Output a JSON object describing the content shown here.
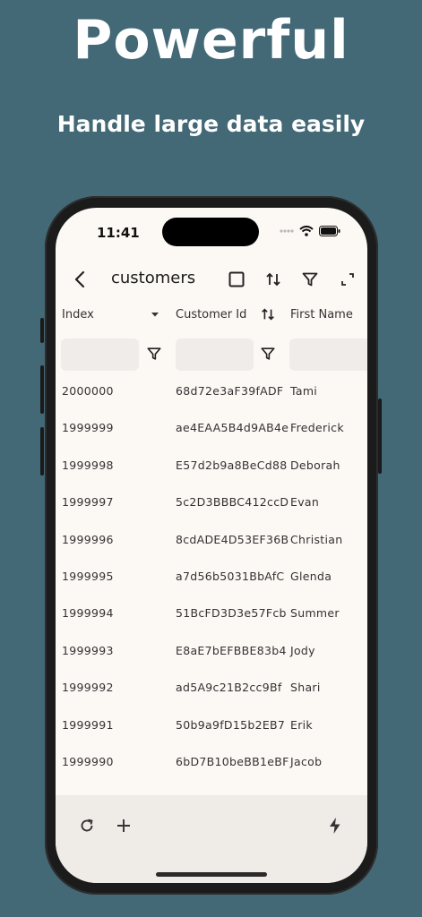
{
  "promo": {
    "headline": "Powerful",
    "subheadline": "Handle large data easily"
  },
  "status_bar": {
    "time": "11:41"
  },
  "toolbar": {
    "title": "customers",
    "icons": [
      "back-arrow-icon",
      "checkbox-icon",
      "sort-icon",
      "filter-icon",
      "fullscreen-icon"
    ]
  },
  "table": {
    "columns": [
      {
        "label": "Index",
        "icon": "dropdown-arrow-icon"
      },
      {
        "label": "Customer Id",
        "icon": "sort-icon"
      },
      {
        "label": "First Name"
      }
    ],
    "filters": [
      {
        "value": "",
        "placeholder": ""
      },
      {
        "value": "",
        "placeholder": ""
      },
      {
        "value": "",
        "placeholder": ""
      }
    ],
    "rows": [
      [
        "2000000",
        "68d72e3aF39fADF",
        "Tami"
      ],
      [
        "1999999",
        "ae4EAA5B4d9AB4e",
        "Frederick"
      ],
      [
        "1999998",
        "E57d2b9a8BeCd88",
        "Deborah"
      ],
      [
        "1999997",
        "5c2D3BBBC412ccD",
        "Evan"
      ],
      [
        "1999996",
        "8cdADE4D53EF36B",
        "Christian"
      ],
      [
        "1999995",
        "a7d56b5031BbAfC",
        "Glenda"
      ],
      [
        "1999994",
        "51BcFD3D3e57Fcb",
        "Summer"
      ],
      [
        "1999993",
        "E8aE7bEFBBE83b4",
        "Jody"
      ],
      [
        "1999992",
        "ad5A9c21B2cc9Bf",
        "Shari"
      ],
      [
        "1999991",
        "50b9a9fD15b2EB7",
        "Erik"
      ],
      [
        "1999990",
        "6bD7B10beBB1eBF",
        "Jacob"
      ]
    ]
  },
  "bottom_bar": {
    "icons": [
      "refresh-icon",
      "add-icon",
      "lightning-icon"
    ]
  },
  "colors": {
    "background": "#436876",
    "screen": "#fcf8f4",
    "bottom_bar": "#efebe7"
  }
}
